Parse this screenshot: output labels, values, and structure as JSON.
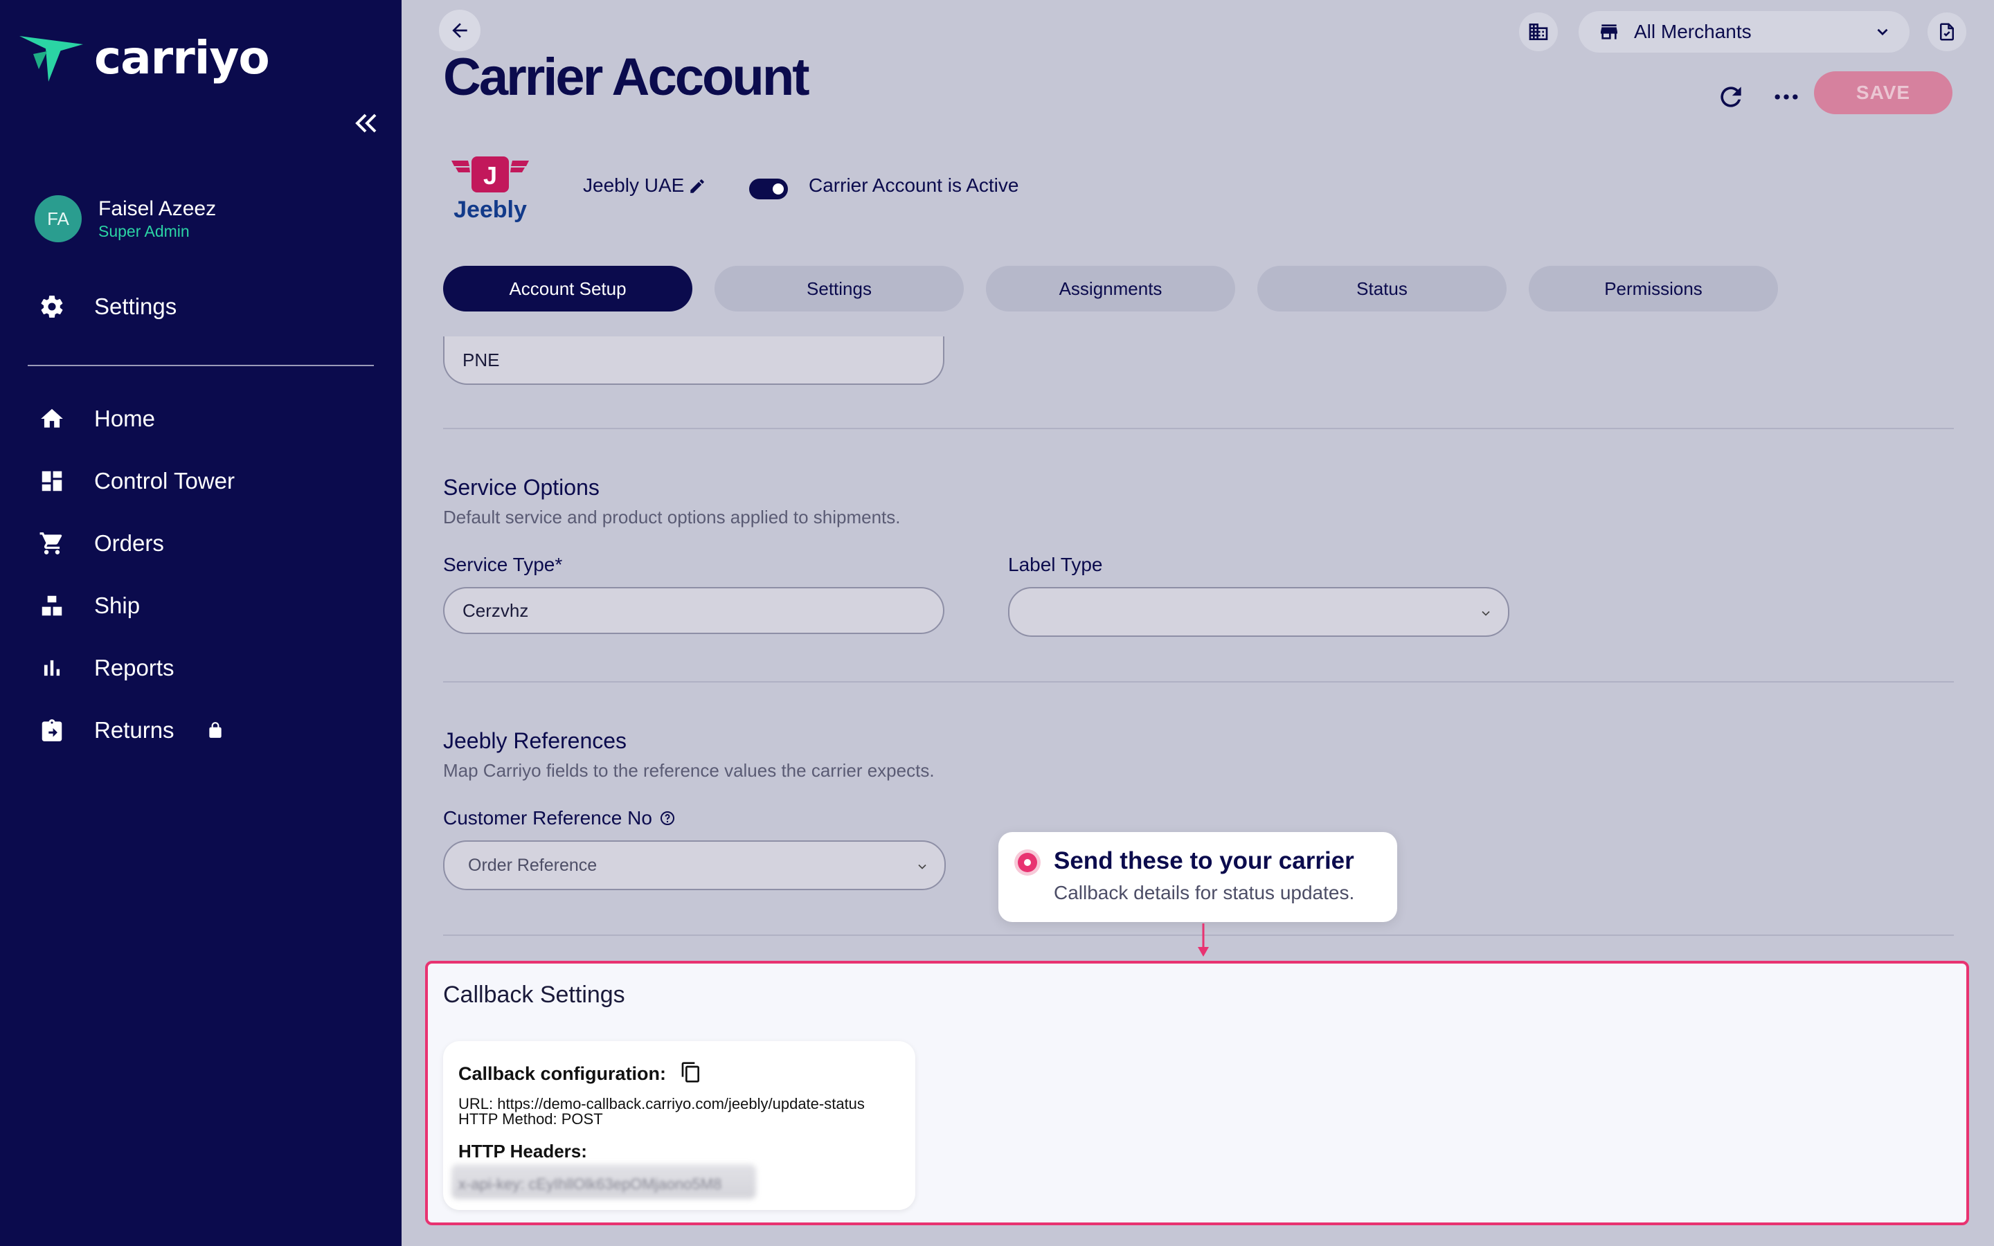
{
  "app": {
    "logo_text": "carriyo"
  },
  "user": {
    "initials": "FA",
    "name": "Faisel Azeez",
    "role": "Super Admin"
  },
  "sidebar": {
    "settings_label": "Settings",
    "items": [
      {
        "label": "Home",
        "icon": "home-icon"
      },
      {
        "label": "Control Tower",
        "icon": "dashboard-icon"
      },
      {
        "label": "Orders",
        "icon": "cart-icon"
      },
      {
        "label": "Ship",
        "icon": "ship-icon"
      },
      {
        "label": "Reports",
        "icon": "bar-chart-icon"
      },
      {
        "label": "Returns",
        "icon": "returns-icon",
        "locked": true
      }
    ]
  },
  "header": {
    "title": "Carrier Account",
    "merchant_select": "All Merchants",
    "save_label": "SAVE"
  },
  "carrier": {
    "logo_text": "Jeebly",
    "logo_letter": "J",
    "name": "Jeebly UAE",
    "active_label": "Carrier Account is Active",
    "active": true
  },
  "tabs": [
    {
      "label": "Account Setup",
      "active": true
    },
    {
      "label": "Settings",
      "active": false
    },
    {
      "label": "Assignments",
      "active": false
    },
    {
      "label": "Status",
      "active": false
    },
    {
      "label": "Permissions",
      "active": false
    }
  ],
  "form": {
    "top_field_value": "PNE",
    "service_options": {
      "title": "Service Options",
      "description": "Default service and product options applied to shipments.",
      "service_type_label": "Service Type*",
      "service_type_value": "Cerzvhz",
      "label_type_label": "Label Type",
      "label_type_value": ""
    },
    "references": {
      "title": "Jeebly References",
      "description": "Map Carriyo fields to the reference values the carrier expects.",
      "customer_ref_label": "Customer Reference No",
      "customer_ref_value": "Order Reference"
    }
  },
  "callback": {
    "title": "Callback Settings",
    "config_label": "Callback configuration:",
    "url_line": "URL: https://demo-callback.carriyo.com/jeebly/update-status",
    "method_line": "HTTP Method: POST",
    "headers_label": "HTTP Headers:",
    "headers_value": "x-api-key: cEyIhllOlk63epOMjaono5M8"
  },
  "tooltip": {
    "title": "Send these to your carrier",
    "text": "Callback details for status updates."
  },
  "colors": {
    "sidebar_bg": "#0b0b4d",
    "main_bg": "#c5c6d5",
    "accent_pink": "#e83371",
    "user_role": "#2bd4a4"
  }
}
